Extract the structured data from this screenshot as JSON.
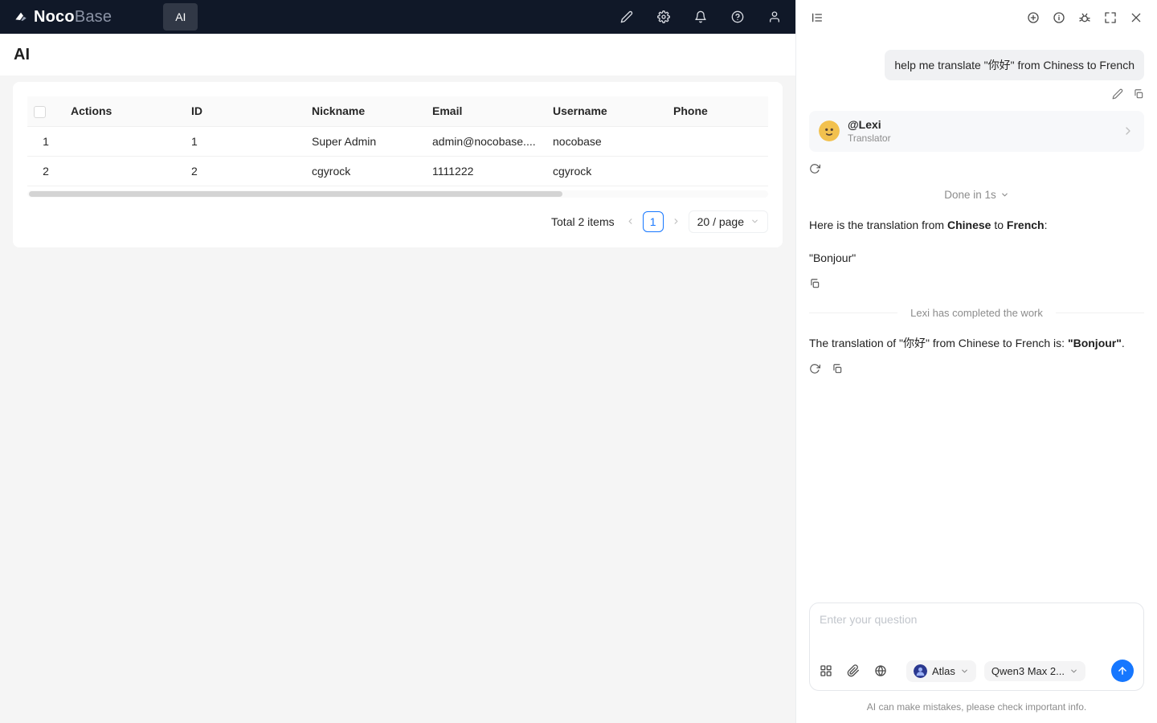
{
  "colors": {
    "accent": "#1677ff",
    "header_bg": "#101828"
  },
  "header": {
    "logo_primary": "Noco",
    "logo_secondary": "Base",
    "tab_label": "AI"
  },
  "page": {
    "title": "AI"
  },
  "table": {
    "headers": [
      "Actions",
      "ID",
      "Nickname",
      "Email",
      "Username",
      "Phone"
    ],
    "rows": [
      {
        "index": "1",
        "id": "1",
        "nickname": "Super Admin",
        "email": "admin@nocobase....",
        "username": "nocobase",
        "phone": ""
      },
      {
        "index": "2",
        "id": "2",
        "nickname": "cgyrock",
        "email": "1111222",
        "username": "cgyrock",
        "phone": ""
      }
    ],
    "pagination": {
      "total_label": "Total 2 items",
      "current_page": "1",
      "page_size_label": "20 / page"
    }
  },
  "chat": {
    "user_message": "help me translate \"你好\" from Chiness to French",
    "agent_card": {
      "name": "@Lexi",
      "role": "Translator"
    },
    "status": {
      "done_label": "Done in 1s"
    },
    "response": {
      "intro_1": "Here is the translation from ",
      "intro_bold_1": "Chinese",
      "intro_2": " to ",
      "intro_bold_2": "French",
      "intro_3": ":",
      "quote": "\"Bonjour\""
    },
    "divider_text": "Lexi has completed the work",
    "final": {
      "text_1": "The translation of \"你好\" from Chinese to French is: ",
      "bold": "\"Bonjour\"",
      "text_2": "."
    },
    "input": {
      "placeholder": "Enter your question",
      "agent_chip": "Atlas",
      "model_chip": "Qwen3 Max 2..."
    },
    "footer_note": "AI can make mistakes, please check important info."
  }
}
